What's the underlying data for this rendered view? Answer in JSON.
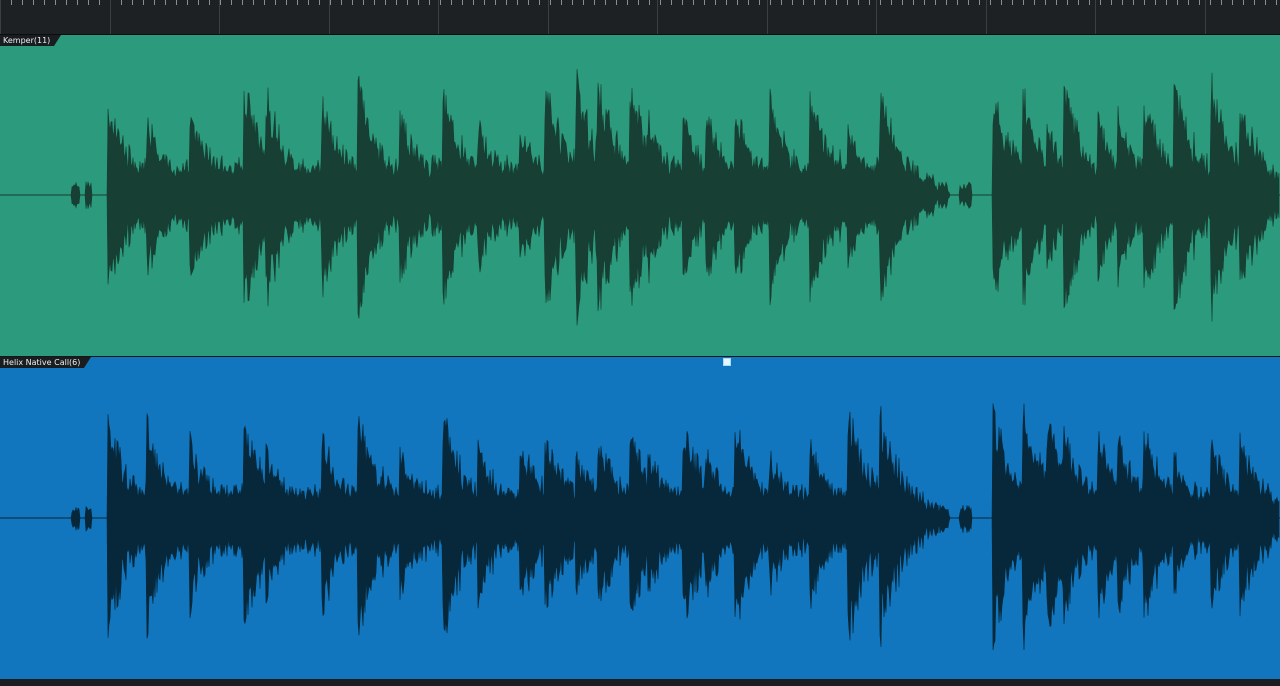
{
  "tracks": [
    {
      "name": "Kemper(11)",
      "color": "#2c9b7d",
      "wave_color": "#173f33"
    },
    {
      "name": "Helix Native Call(6)",
      "color": "#1176bd",
      "wave_color": "#07283a",
      "selected": true
    }
  ]
}
